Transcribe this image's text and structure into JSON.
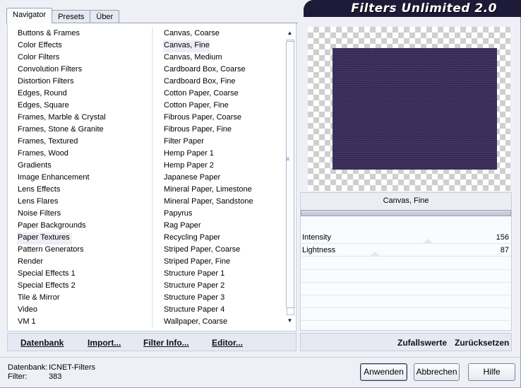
{
  "window": {
    "banner_title": "Filters Unlimited 2.0"
  },
  "tabs": [
    {
      "label": "Navigator",
      "active": true
    },
    {
      "label": "Presets",
      "active": false
    },
    {
      "label": "Über",
      "active": false
    }
  ],
  "categories": {
    "selected": "Paper Textures",
    "items": [
      "Buttons & Frames",
      "Color Effects",
      "Color Filters",
      "Convolution Filters",
      "Distortion Filters",
      "Edges, Round",
      "Edges, Square",
      "Frames, Marble & Crystal",
      "Frames, Stone & Granite",
      "Frames, Textured",
      "Frames, Wood",
      "Gradients",
      "Image Enhancement",
      "Lens Effects",
      "Lens Flares",
      "Noise Filters",
      "Paper Backgrounds",
      "Paper Textures",
      "Pattern Generators",
      "Render",
      "Special Effects 1",
      "Special Effects 2",
      "Tile & Mirror",
      "Video",
      "VM 1"
    ]
  },
  "filters": {
    "selected": "Canvas, Fine",
    "items": [
      "Canvas, Coarse",
      "Canvas, Fine",
      "Canvas, Medium",
      "Cardboard Box, Coarse",
      "Cardboard Box, Fine",
      "Cotton Paper, Coarse",
      "Cotton Paper, Fine",
      "Fibrous Paper, Coarse",
      "Fibrous Paper, Fine",
      "Filter Paper",
      "Hemp Paper 1",
      "Hemp Paper 2",
      "Japanese Paper",
      "Mineral Paper, Limestone",
      "Mineral Paper, Sandstone",
      "Papyrus",
      "Rag Paper",
      "Recycling Paper",
      "Striped Paper, Coarse",
      "Striped Paper, Fine",
      "Structure Paper 1",
      "Structure Paper 2",
      "Structure Paper 3",
      "Structure Paper 4",
      "Wallpaper, Coarse"
    ]
  },
  "left_links": {
    "database": "Datenbank",
    "import": "Import...",
    "filter_info": "Filter Info...",
    "editor": "Editor..."
  },
  "preview": {
    "filter_name": "Canvas, Fine",
    "colors": {
      "image": "#3a2d5b",
      "checker": "#cfcfcf"
    }
  },
  "params": [
    {
      "label": "Intensity",
      "value": "156",
      "level": 156
    },
    {
      "label": "Lightness",
      "value": "87",
      "level": 87
    }
  ],
  "right_links": {
    "random": "Zufallswerte",
    "reset": "Zurücksetzen"
  },
  "status": {
    "database_key": "Datenbank:",
    "database_value": "ICNET-Filters",
    "filter_key": "Filter:",
    "filter_value": "383"
  },
  "buttons": {
    "apply": "Anwenden",
    "cancel": "Abbrechen",
    "help": "Hilfe"
  },
  "colors": {
    "banner": "#1d1b38",
    "accent_border": "#30365a"
  }
}
